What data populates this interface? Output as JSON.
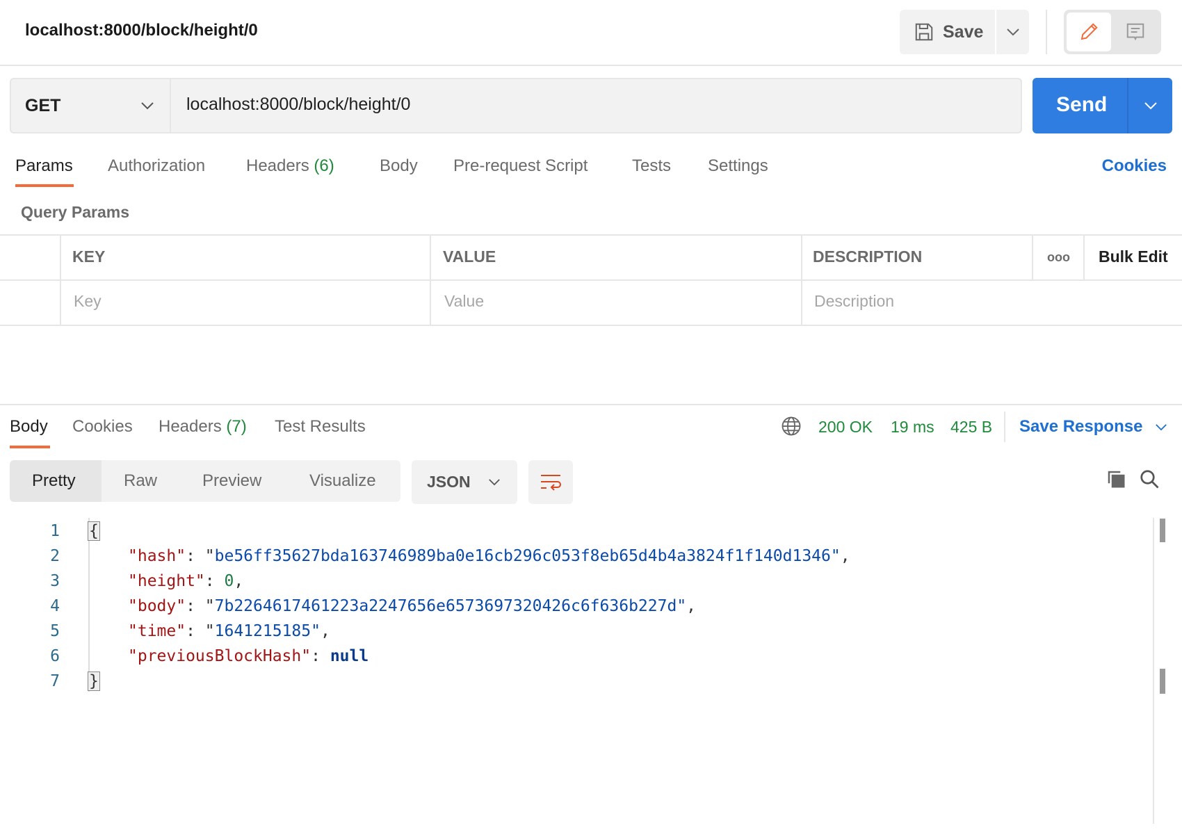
{
  "header": {
    "title": "localhost:8000/block/height/0",
    "save_label": "Save"
  },
  "request": {
    "method": "GET",
    "url": "localhost:8000/block/height/0",
    "send_label": "Send"
  },
  "request_tabs": [
    {
      "label": "Params",
      "active": true
    },
    {
      "label": "Authorization"
    },
    {
      "label": "Headers",
      "count": "(6)"
    },
    {
      "label": "Body"
    },
    {
      "label": "Pre-request Script"
    },
    {
      "label": "Tests"
    },
    {
      "label": "Settings"
    }
  ],
  "cookies_label": "Cookies",
  "query_params": {
    "title": "Query Params",
    "columns": [
      "KEY",
      "VALUE",
      "DESCRIPTION"
    ],
    "bulk_edit": "Bulk Edit",
    "more": "ooo",
    "placeholders": [
      "Key",
      "Value",
      "Description"
    ]
  },
  "response": {
    "tabs": [
      {
        "label": "Body",
        "active": true
      },
      {
        "label": "Cookies"
      },
      {
        "label": "Headers",
        "count": "(7)"
      },
      {
        "label": "Test Results"
      }
    ],
    "status": "200 OK",
    "time": "19 ms",
    "size": "425 B",
    "save_response": "Save Response",
    "views": [
      "Pretty",
      "Raw",
      "Preview",
      "Visualize"
    ],
    "active_view": "Pretty",
    "format": "JSON",
    "lines": [
      "1",
      "2",
      "3",
      "4",
      "5",
      "6",
      "7"
    ],
    "json": {
      "hash": "be56ff35627bda163746989ba0e16cb296c053f8eb65d4b4a3824f1f140d1346",
      "height": "0",
      "body": "7b2264617461223a2247656e6573697320426c6f636b227d",
      "time": "1641215185",
      "previousBlockHash": "null"
    },
    "keys": [
      "\"hash\"",
      "\"height\"",
      "\"body\"",
      "\"time\"",
      "\"previousBlockHash\""
    ]
  },
  "colors": {
    "accent": "#f26b3a",
    "send": "#2f7de1",
    "status": "#1f8a3b",
    "link": "#1f6fd1"
  }
}
